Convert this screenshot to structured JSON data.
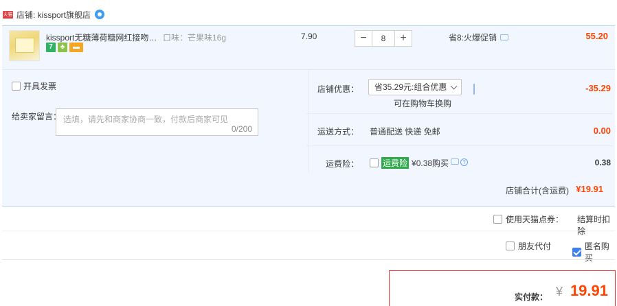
{
  "shop": {
    "badge": "天猫",
    "name": "店铺: kissport旗舰店"
  },
  "item": {
    "title": "kissport无糖薄荷糖网红接吻香...",
    "sku": "口味：芒果味16g",
    "service_icons": [
      "7",
      "gold-leaf-icon",
      "card-icon"
    ],
    "unit_price": "7.90",
    "quantity": "8",
    "qty_minus": "−",
    "qty_plus": "+",
    "promo": "省8:火爆促销",
    "subtotal": "55.20"
  },
  "invoice": {
    "label": "开具发票"
  },
  "message": {
    "label": "给卖家留言：",
    "placeholder": "选填，请先和商家协商一致，付款后商家可见",
    "count": "0/200"
  },
  "shop_discount": {
    "label": "店铺优惠：",
    "selected": "省35.29元:组合优惠",
    "hint": "可在购物车换购",
    "amount": "-35.29"
  },
  "shipping": {
    "label": "运送方式：",
    "value": "普通配送 快递 免邮",
    "amount": "0.00"
  },
  "insurance": {
    "label": "运费险：",
    "tag": "运费险",
    "value": "¥0.38购买",
    "amount": "0.38"
  },
  "shop_total": {
    "label": "店铺合计(含运费)",
    "amount": "¥19.91"
  },
  "tmall_points": {
    "label": "使用天猫点券：",
    "note": "结算时扣除"
  },
  "friend_pay": {
    "label": "朋友代付"
  },
  "anonymous": {
    "label": "匿名购买"
  },
  "payment": {
    "label": "实付款：",
    "currency": "¥",
    "amount": "19.91"
  },
  "colors": {
    "accent_red": "#ff4400",
    "row_bg": "#f2f7ff",
    "border_blue": "#b2d1ff"
  }
}
